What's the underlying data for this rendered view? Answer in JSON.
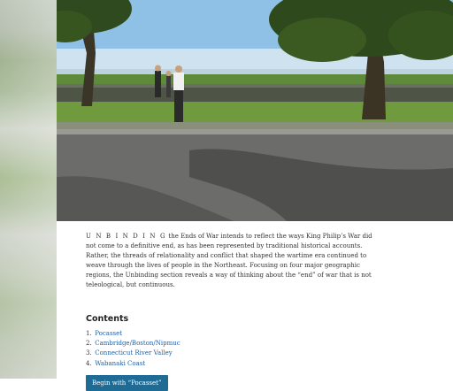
{
  "hero": {
    "image_name": "landscape-photo-people-road"
  },
  "intro": {
    "lead_smallcaps": "U N B I N D I N G",
    "body": " the Ends of War intends to reflect the ways King Philip’s War did not come to a definitive end, as has been represented by traditional historical accounts. Rather, the threads of relationality and conflict that shaped the wartime era continued to weave through the lives of people in the Northeast. Focusing on four major geographic regions, the Unbinding section reveals a way of thinking about the “end” of war that is not teleological, but continuous."
  },
  "contents": {
    "heading": "Contents",
    "items": [
      {
        "num": "1.",
        "label": "Pocasset"
      },
      {
        "num": "2.",
        "label": "Cambridge/Boston/Nipmuc"
      },
      {
        "num": "3.",
        "label": "Connecticut River Valley"
      },
      {
        "num": "4.",
        "label": "Wabanaki Coast"
      }
    ]
  },
  "begin_button": {
    "label": "Begin with “Pocasset”"
  },
  "colors": {
    "link": "#1f5fa3",
    "button_bg": "#1e6b96",
    "text": "#333333"
  }
}
